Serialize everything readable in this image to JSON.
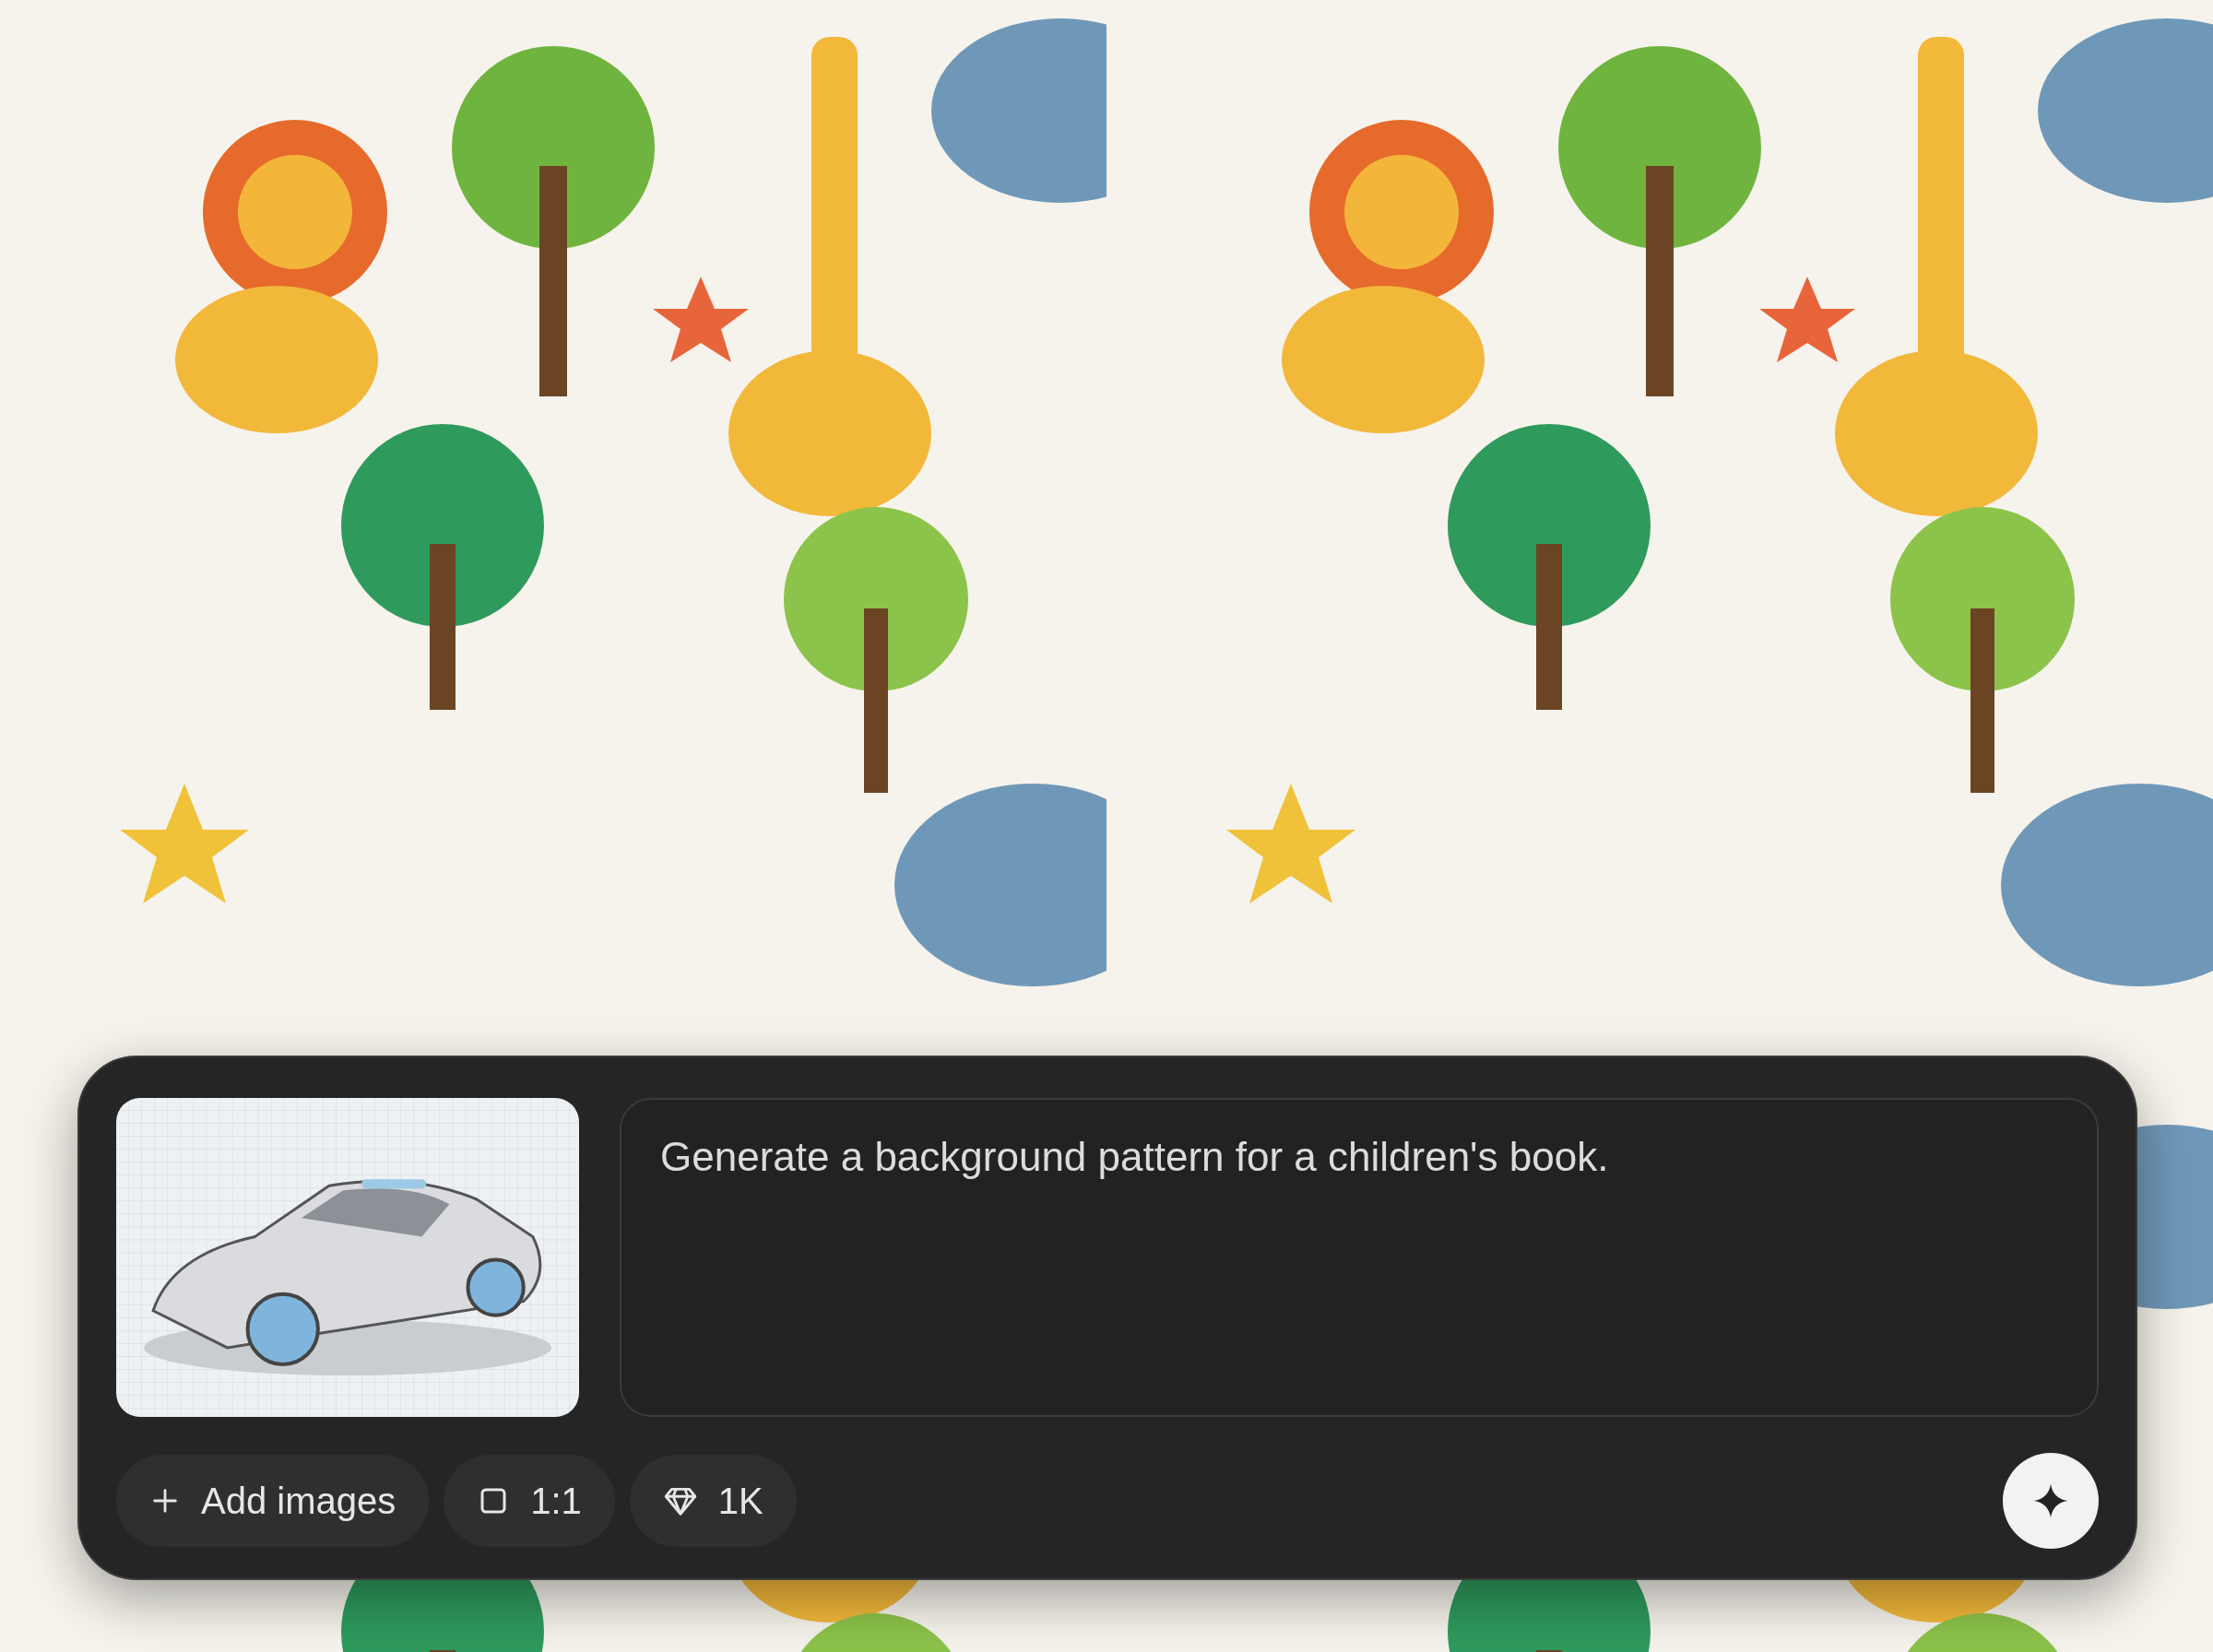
{
  "composer": {
    "prompt": {
      "value": "Generate a background pattern for a children's book."
    },
    "options": [
      {
        "kind": "add",
        "label": "Add images"
      },
      {
        "kind": "aspect",
        "label": "1:1"
      },
      {
        "kind": "quality",
        "label": "1K"
      }
    ]
  }
}
